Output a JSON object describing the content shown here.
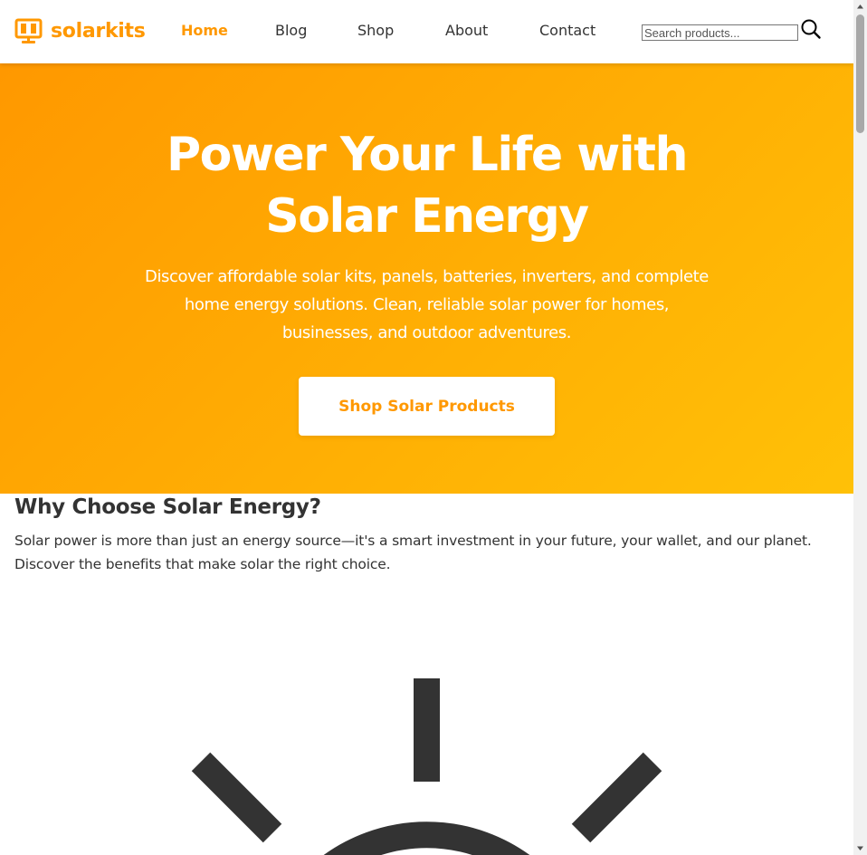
{
  "header": {
    "brand": "solarkits",
    "logo_icon": "solar-panel-icon",
    "nav": [
      {
        "label": "Home",
        "active": true
      },
      {
        "label": "Blog",
        "active": false
      },
      {
        "label": "Shop",
        "active": false
      },
      {
        "label": "About",
        "active": false
      },
      {
        "label": "Contact",
        "active": false
      }
    ],
    "search": {
      "placeholder": "Search products...",
      "value": "",
      "icon": "search-icon"
    }
  },
  "hero": {
    "title_line1": "Power Your Life with",
    "title_line2": "Solar Energy",
    "subtitle_line1": "Discover affordable solar kits, panels, batteries, inverters, and complete",
    "subtitle_line2": "home energy solutions. Clean, reliable solar power for homes,",
    "subtitle_line3": "businesses, and outdoor adventures.",
    "cta_label": "Shop Solar Products"
  },
  "benefits": {
    "title": "Why Choose Solar Energy?",
    "description_line1": "Solar power is more than just an energy source—it's a smart investment in your future, your wallet, and our planet.",
    "description_line2": "Discover the benefits that make solar the right choice.",
    "illustration_icon": "sun-icon"
  },
  "colors": {
    "brand": "#ff9800",
    "hero_gradient_start": "#ff9800",
    "hero_gradient_end": "#ffc107",
    "text": "#333333",
    "background": "#ffffff"
  }
}
